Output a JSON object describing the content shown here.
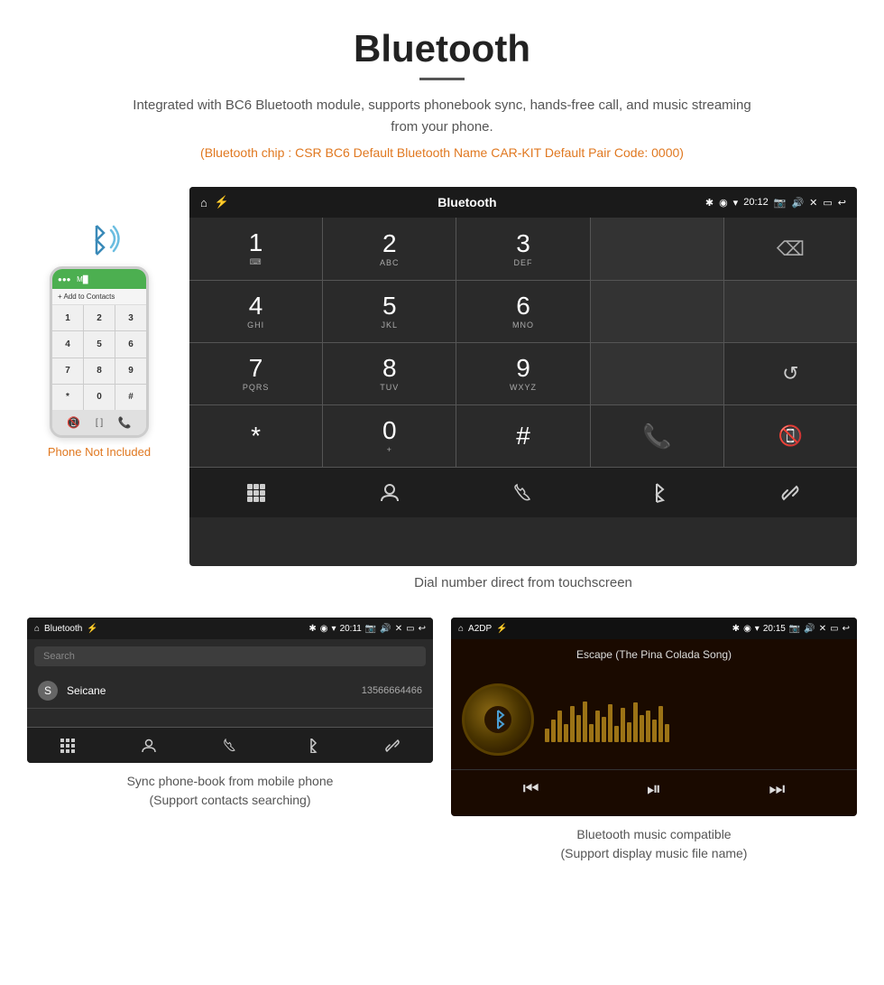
{
  "header": {
    "title": "Bluetooth",
    "subtitle": "Integrated with BC6 Bluetooth module, supports phonebook sync, hands-free call, and music streaming from your phone.",
    "specs": "(Bluetooth chip : CSR BC6    Default Bluetooth Name CAR-KIT    Default Pair Code: 0000)"
  },
  "phone_label": "Phone Not Included",
  "dial_screen": {
    "status_title": "Bluetooth",
    "time": "20:12",
    "keypad": [
      {
        "main": "1",
        "sub": ""
      },
      {
        "main": "2",
        "sub": "ABC"
      },
      {
        "main": "3",
        "sub": "DEF"
      },
      {
        "main": "",
        "sub": ""
      },
      {
        "main": "⌫",
        "sub": ""
      },
      {
        "main": "4",
        "sub": "GHI"
      },
      {
        "main": "5",
        "sub": "JKL"
      },
      {
        "main": "6",
        "sub": "MNO"
      },
      {
        "main": "",
        "sub": ""
      },
      {
        "main": "",
        "sub": ""
      },
      {
        "main": "7",
        "sub": "PQRS"
      },
      {
        "main": "8",
        "sub": "TUV"
      },
      {
        "main": "9",
        "sub": "WXYZ"
      },
      {
        "main": "",
        "sub": ""
      },
      {
        "main": "↺",
        "sub": ""
      },
      {
        "main": "*",
        "sub": ""
      },
      {
        "main": "0",
        "sub": "+"
      },
      {
        "main": "#",
        "sub": ""
      },
      {
        "main": "📞",
        "sub": ""
      },
      {
        "main": "📵",
        "sub": ""
      }
    ],
    "bottom_icons": [
      "⊞",
      "👤",
      "📞",
      "✱",
      "🔗"
    ]
  },
  "dial_caption": "Dial number direct from touchscreen",
  "phonebook_screen": {
    "status_title": "Bluetooth",
    "time": "20:11",
    "search_placeholder": "Search",
    "contacts": [
      {
        "initial": "S",
        "name": "Seicane",
        "number": "13566664466"
      }
    ],
    "bottom_icons": [
      "⊞",
      "👤",
      "📞",
      "✱",
      "🔗"
    ]
  },
  "phonebook_caption": "Sync phone-book from mobile phone\n(Support contacts searching)",
  "music_screen": {
    "status_title": "A2DP",
    "time": "20:15",
    "song_title": "Escape (The Pina Colada Song)",
    "visualizer_heights": [
      15,
      25,
      35,
      20,
      40,
      30,
      45,
      20,
      35,
      28,
      42,
      18,
      38,
      22,
      44,
      30,
      35,
      25,
      40,
      20
    ],
    "controls": [
      "⏮",
      "⏯",
      "⏭"
    ]
  },
  "music_caption": "Bluetooth music compatible\n(Support display music file name)"
}
